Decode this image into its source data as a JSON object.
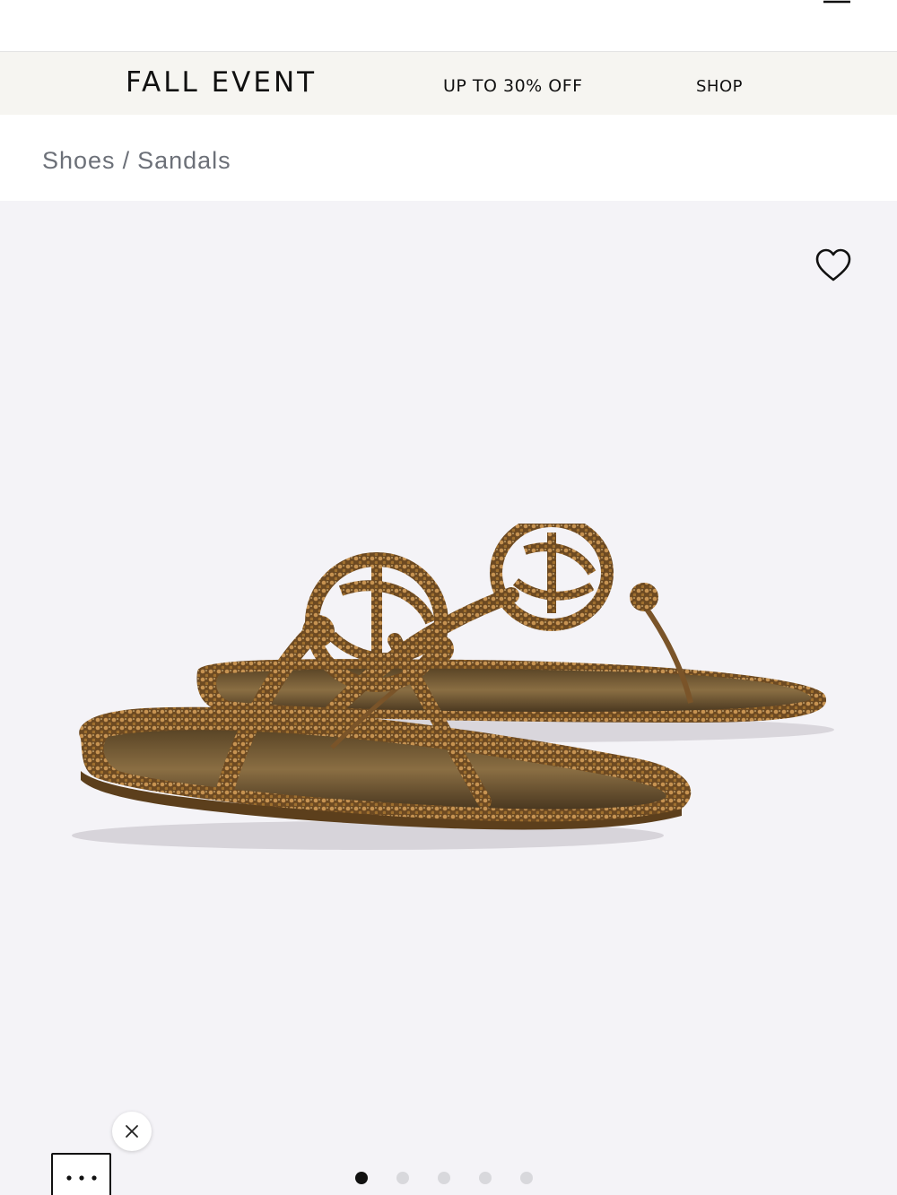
{
  "header": {
    "search_icon": "search-icon",
    "bag_icon": "shopping-bag-icon",
    "menu_icon": "hamburger-menu-icon"
  },
  "promo": {
    "title": "FALL EVENT",
    "offer": "UP TO 30% OFF",
    "shop_label": "SHOP"
  },
  "breadcrumb": {
    "items": [
      "Shoes",
      "Sandals"
    ],
    "separator": "/"
  },
  "gallery": {
    "wishlist_icon": "heart-icon",
    "close_icon": "close-icon",
    "more_icon": "more-options-icon",
    "dots_total": 5,
    "dots_active": 1,
    "background": "#f4f3f7",
    "accent_dark": "#111111"
  }
}
